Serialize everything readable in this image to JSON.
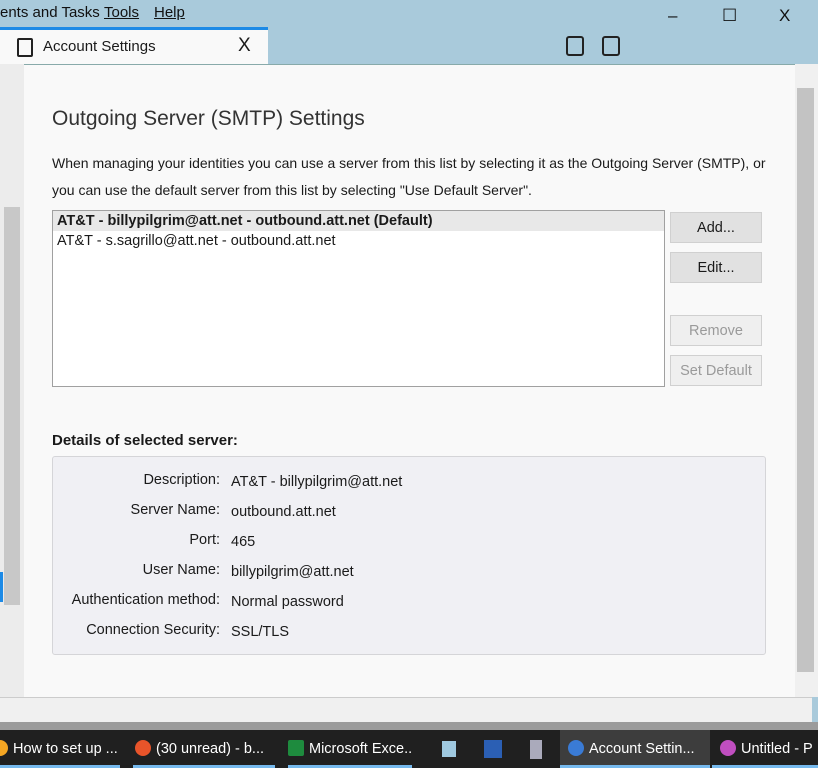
{
  "menubar": {
    "items": [
      "ents and Tasks",
      "Tools",
      "Help"
    ]
  },
  "tab": {
    "label": "Account Settings",
    "close": "X"
  },
  "window_controls": {
    "minimize": "–",
    "maximize": "☐",
    "close": "X"
  },
  "page": {
    "title": "Outgoing Server (SMTP) Settings",
    "description": "When managing your identities you can use a server from this list by selecting it as the Outgoing Server (SMTP), or you can use the default server from this list by selecting \"Use Default Server\".",
    "servers": [
      "AT&T - billypilgrim@att.net - outbound.att.net (Default)",
      "AT&T - s.sagrillo@att.net - outbound.att.net"
    ],
    "buttons": {
      "add": "Add...",
      "edit": "Edit...",
      "remove": "Remove",
      "set_default": "Set Default"
    },
    "details_heading": "Details of selected server:",
    "details": [
      {
        "label": "Description:",
        "value": "AT&T - billypilgrim@att.net"
      },
      {
        "label": "Server Name:",
        "value": "outbound.att.net"
      },
      {
        "label": "Port:",
        "value": "465"
      },
      {
        "label": "User Name:",
        "value": "billypilgrim@att.net"
      },
      {
        "label": "Authentication method:",
        "value": "Normal password"
      },
      {
        "label": "Connection Security:",
        "value": "SSL/TLS"
      }
    ]
  },
  "taskbar": [
    "How to set up ...",
    "(30 unread) - b...",
    "Microsoft Exce...",
    "Account Settin...",
    "Untitled - P"
  ],
  "colors": {
    "accent": "#1d8ae6",
    "menubar": "#a9cadb",
    "taskbar": "#202020"
  }
}
